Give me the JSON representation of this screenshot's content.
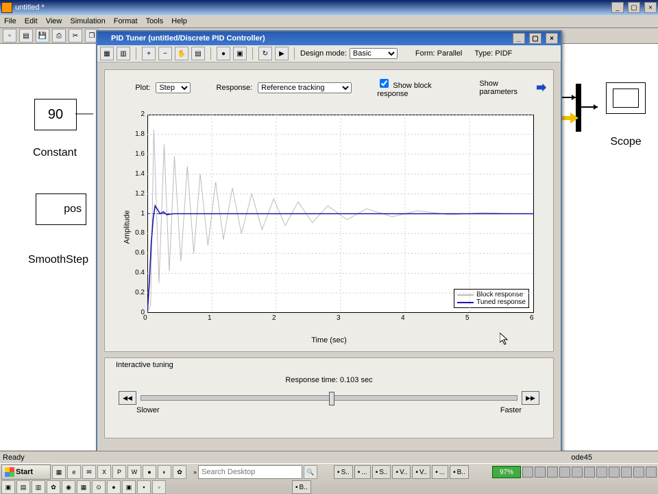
{
  "app": {
    "title": "untitled *"
  },
  "menu": [
    "File",
    "Edit",
    "View",
    "Simulation",
    "Format",
    "Tools",
    "Help"
  ],
  "blocks": {
    "constant_value": "90",
    "constant_label": "Constant",
    "smoothstep_value": "pos",
    "smoothstep_label": "SmoothStep",
    "scope_label": "Scope"
  },
  "pid": {
    "title": "PID Tuner (untitled/Discrete PID Controller)",
    "design_mode_label": "Design mode:",
    "design_mode": "Basic",
    "form_label": "Form: Parallel",
    "type_label": "Type: PIDF",
    "plot_label": "Plot:",
    "plot_value": "Step",
    "response_label": "Response:",
    "response_value": "Reference tracking",
    "show_block": "Show block response",
    "show_params": "Show parameters",
    "legend_block": "Block response",
    "legend_tuned": "Tuned response",
    "ylabel": "Amplitude",
    "xlabel": "Time (sec)",
    "yticks": [
      "0",
      "0.2",
      "0.4",
      "0.6",
      "0.8",
      "1",
      "1.2",
      "1.4",
      "1.6",
      "1.8",
      "2"
    ],
    "xticks": [
      "0",
      "1",
      "2",
      "3",
      "4",
      "5",
      "6"
    ],
    "tuning_header": "Interactive tuning",
    "response_time": "Response time: 0.103 sec",
    "slower": "Slower",
    "faster": "Faster",
    "slider_rewind": "◀◀",
    "slider_fwd": "▶▶"
  },
  "status": {
    "ready": "Ready",
    "solver": "ode45"
  },
  "taskbar": {
    "start": "Start",
    "search_placeholder": "Search Desktop",
    "tasks": [
      "S..",
      "...",
      "S..",
      "V..",
      "V..",
      "...",
      "B.."
    ],
    "task_b": "B..",
    "battery": "97%"
  },
  "chart_data": {
    "type": "line",
    "xlabel": "Time (sec)",
    "ylabel": "Amplitude",
    "xlim": [
      0,
      6
    ],
    "ylim": [
      0,
      2
    ],
    "series": [
      {
        "name": "Block response",
        "color": "#bbbbbb",
        "x": [
          0,
          0.05,
          0.1,
          0.18,
          0.26,
          0.34,
          0.42,
          0.52,
          0.62,
          0.72,
          0.82,
          0.94,
          1.06,
          1.18,
          1.32,
          1.46,
          1.62,
          1.78,
          1.96,
          2.14,
          2.34,
          2.56,
          2.8,
          3.1,
          3.4,
          3.8,
          4.2,
          4.7,
          5.2,
          5.7,
          6.0
        ],
        "y": [
          0,
          0.08,
          1.85,
          0.3,
          1.7,
          0.42,
          1.58,
          0.52,
          1.48,
          0.6,
          1.4,
          0.68,
          1.32,
          0.74,
          1.26,
          0.8,
          1.2,
          0.84,
          1.15,
          0.88,
          1.12,
          0.91,
          1.08,
          0.94,
          1.05,
          0.97,
          1.03,
          0.99,
          1.01,
          1.0,
          1.0
        ]
      },
      {
        "name": "Tuned response",
        "color": "#1818a8",
        "x": [
          0,
          0.03,
          0.06,
          0.09,
          0.12,
          0.15,
          0.2,
          0.25,
          0.3,
          0.4,
          0.5,
          0.7,
          1.0,
          1.5,
          2.0,
          3.0,
          4.0,
          5.0,
          6.0
        ],
        "y": [
          0,
          0.3,
          0.7,
          0.95,
          1.08,
          1.05,
          1.0,
          1.02,
          0.99,
          1.0,
          1.0,
          1.0,
          1.0,
          1.0,
          1.0,
          1.0,
          1.0,
          1.0,
          1.0
        ]
      }
    ]
  }
}
